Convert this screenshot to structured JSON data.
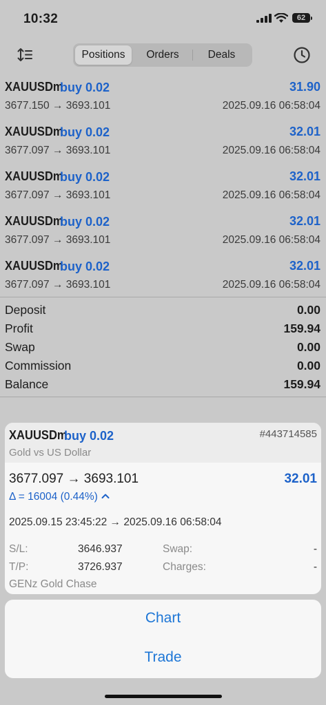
{
  "status_bar": {
    "time": "10:32",
    "battery": "62"
  },
  "toolbar": {
    "tabs": [
      {
        "label": "Positions",
        "active": true
      },
      {
        "label": "Orders",
        "active": false
      },
      {
        "label": "Deals",
        "active": false
      }
    ],
    "icons": [
      "sort-icon",
      "history-clock-icon"
    ]
  },
  "positions": [
    {
      "symbol": "XAUUSDm",
      "side": "buy 0.02",
      "profit": "31.90",
      "prices": "3677.150 → 3693.101",
      "time": "2025.09.16 06:58:04"
    },
    {
      "symbol": "XAUUSDm",
      "side": "buy 0.02",
      "profit": "32.01",
      "prices": "3677.097 → 3693.101",
      "time": "2025.09.16 06:58:04"
    },
    {
      "symbol": "XAUUSDm",
      "side": "buy 0.02",
      "profit": "32.01",
      "prices": "3677.097 → 3693.101",
      "time": "2025.09.16 06:58:04"
    },
    {
      "symbol": "XAUUSDm",
      "side": "buy 0.02",
      "profit": "32.01",
      "prices": "3677.097 → 3693.101",
      "time": "2025.09.16 06:58:04"
    },
    {
      "symbol": "XAUUSDm",
      "side": "buy 0.02",
      "profit": "32.01",
      "prices": "3677.097 → 3693.101",
      "time": "2025.09.16 06:58:04"
    }
  ],
  "summary": [
    {
      "label": "Deposit",
      "value": "0.00"
    },
    {
      "label": "Profit",
      "value": "159.94"
    },
    {
      "label": "Swap",
      "value": "0.00"
    },
    {
      "label": "Commission",
      "value": "0.00"
    },
    {
      "label": "Balance",
      "value": "159.94"
    }
  ],
  "detail": {
    "symbol": "XAUUSDm",
    "side": "buy 0.02",
    "ticket": "#443714585",
    "description": "Gold vs US Dollar",
    "prices": "3677.097 → 3693.101",
    "profit": "32.01",
    "delta": "Δ = 16004 (0.44%)",
    "times": "2025.09.15 23:45:22 → 2025.09.16 06:58:04",
    "sl_label": "S/L:",
    "sl_value": "3646.937",
    "tp_label": "T/P:",
    "tp_value": "3726.937",
    "swap_label": "Swap:",
    "swap_value": "-",
    "charges_label": "Charges:",
    "charges_value": "-",
    "comment": "GENz Gold Chase"
  },
  "actions": {
    "chart": "Chart",
    "trade": "Trade"
  },
  "colors": {
    "accent": "#1d62c9",
    "link": "#1d76d6",
    "background": "#c9c9c9"
  }
}
